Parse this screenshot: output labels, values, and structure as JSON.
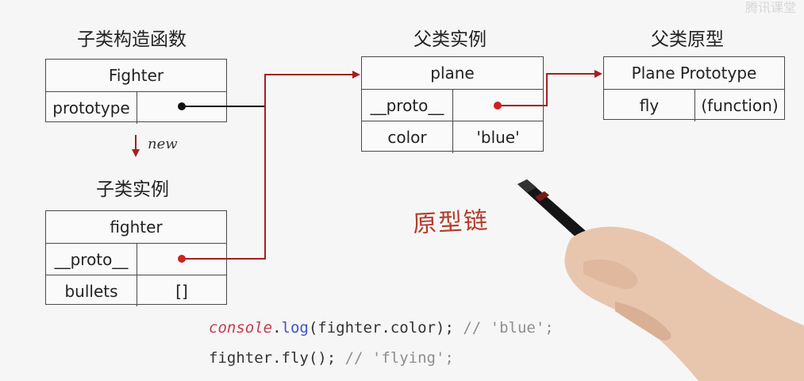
{
  "titles": {
    "subclass_constructor": "子类构造函数",
    "subclass_instance": "子类实例",
    "parent_instance": "父类实例",
    "parent_prototype": "父类原型"
  },
  "fighter_ctor": {
    "name": "Fighter",
    "rows": [
      [
        "prototype",
        ""
      ]
    ]
  },
  "fighter_instance": {
    "name": "fighter",
    "rows": [
      [
        "__proto__",
        ""
      ],
      [
        "bullets",
        "[]"
      ]
    ]
  },
  "plane_instance": {
    "name": "plane",
    "rows": [
      [
        "__proto__",
        ""
      ],
      [
        "color",
        "'blue'"
      ]
    ]
  },
  "plane_prototype": {
    "name": "Plane Prototype",
    "rows": [
      [
        "fly",
        "(function)"
      ]
    ]
  },
  "arrow_new_label": "new",
  "handwritten": "原型链",
  "code": {
    "line1": {
      "console": "console",
      "dot": ".",
      "log": "log",
      "args": "(fighter.color); ",
      "comment": "// 'blue';"
    },
    "line2": {
      "stmt": "fighter.fly(); ",
      "comment": "// 'flying';"
    }
  },
  "watermark": "腾讯课堂",
  "colors": {
    "pointer": "#a51f1f",
    "line_dark": "#111111"
  }
}
